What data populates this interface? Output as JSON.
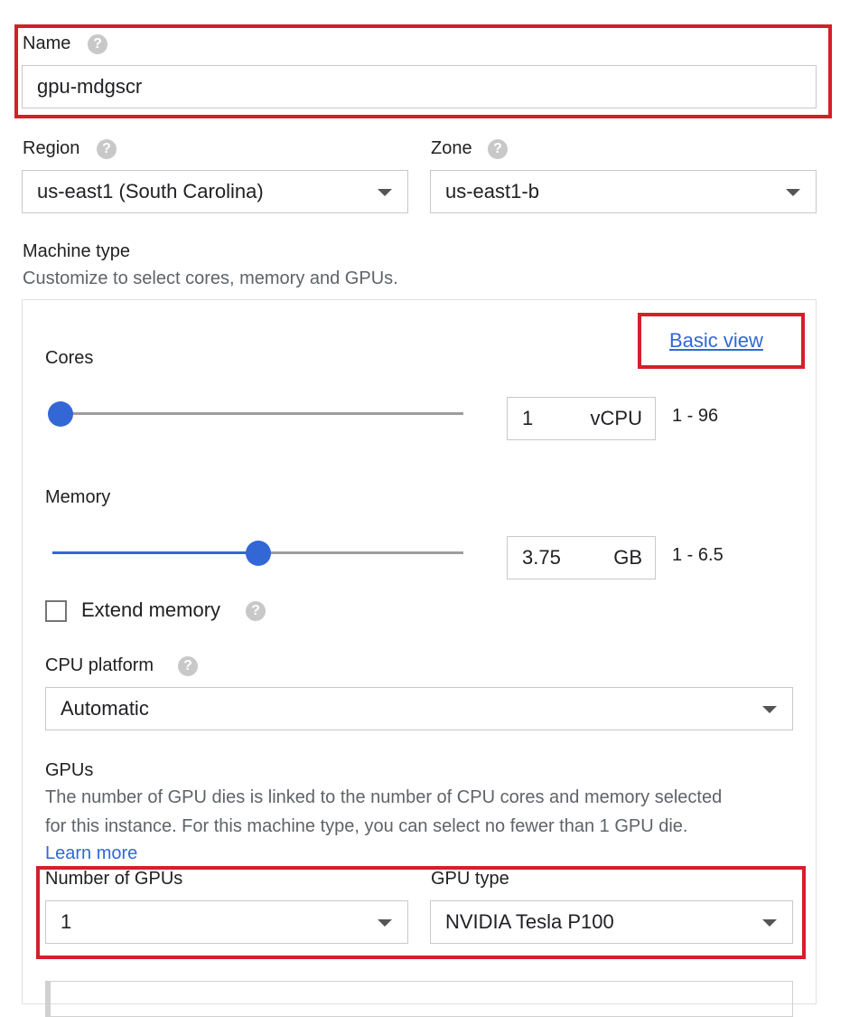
{
  "name": {
    "label": "Name",
    "value": "gpu-mdgscr"
  },
  "region": {
    "label": "Region",
    "value": "us-east1 (South Carolina)"
  },
  "zone": {
    "label": "Zone",
    "value": "us-east1-b"
  },
  "machine_type": {
    "label": "Machine type",
    "description": "Customize to select cores, memory and GPUs.",
    "basic_view_link": "Basic view"
  },
  "cores": {
    "label": "Cores",
    "value": "1",
    "unit": "vCPU",
    "range": "1 - 96",
    "slider_fraction": 0.0
  },
  "memory": {
    "label": "Memory",
    "value": "3.75",
    "unit": "GB",
    "range": "1 - 6.5",
    "slider_fraction": 0.5
  },
  "extend_memory": {
    "label": "Extend memory",
    "checked": false
  },
  "cpu_platform": {
    "label": "CPU platform",
    "value": "Automatic"
  },
  "gpus": {
    "label": "GPUs",
    "description_line1": "The number of GPU dies is linked to the number of CPU cores and memory selected",
    "description_line2": "for this instance. For this machine type, you can select no fewer than 1 GPU die.",
    "learn_more": "Learn more",
    "count_label": "Number of GPUs",
    "count_value": "1",
    "type_label": "GPU type",
    "type_value": "NVIDIA Tesla P100"
  },
  "help_glyph": "?",
  "colors": {
    "accent": "#3367d6",
    "highlight": "#d3202a"
  }
}
